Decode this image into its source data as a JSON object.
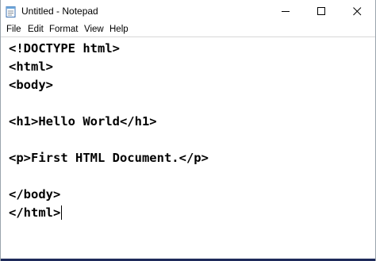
{
  "window": {
    "title": "Untitled - Notepad",
    "app_icon": "notepad-icon",
    "controls": {
      "minimize_icon": "minimize-icon",
      "maximize_icon": "maximize-icon",
      "close_icon": "close-icon"
    }
  },
  "menubar": {
    "items": [
      {
        "label": "File"
      },
      {
        "label": "Edit"
      },
      {
        "label": "Format"
      },
      {
        "label": "View"
      },
      {
        "label": "Help"
      }
    ]
  },
  "editor": {
    "lines": [
      "<!DOCTYPE html>",
      "<html>",
      "<body>",
      "",
      "<h1>Hello World</h1>",
      "",
      "<p>First HTML Document.</p>",
      "",
      "</body>",
      "</html>"
    ]
  },
  "colors": {
    "text": "#000000",
    "background": "#ffffff",
    "border": "#9aa4ad"
  }
}
